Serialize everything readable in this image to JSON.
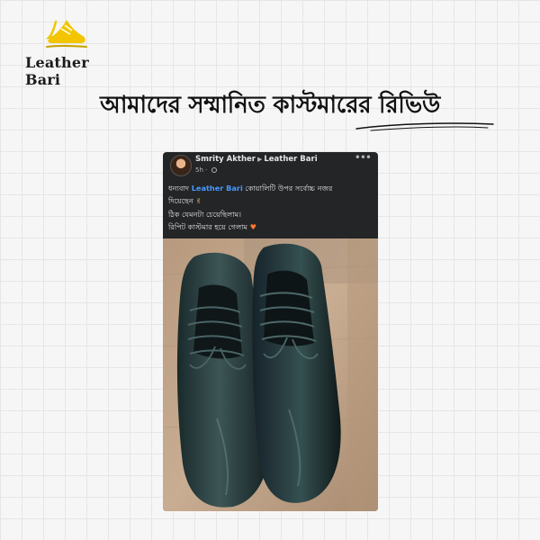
{
  "brand": {
    "name": "Leather Bari"
  },
  "headline": "আমাদের সম্মানিত কাস্টমারের রিভিউ",
  "post": {
    "author": "Smrity Akther",
    "page": "Leather Bari",
    "time": "5h",
    "lines": [
      {
        "before": "ধন্যবাদ ",
        "mention": "Leather Bari",
        "after": " কোয়ালিটি উপর সর্বোচ্চ  নজর"
      },
      {
        "text": "দিয়েছেন",
        "emoji": "hand-icon"
      },
      {
        "text": "ঠিক যেমনটা চেয়েছিলাম।"
      },
      {
        "text": "রিপিট কাস্টমার হয়ে গেলাম",
        "emoji": "heart-eyes-icon"
      }
    ],
    "photo": {
      "subject": "black leather lace-up shoes",
      "icon": "shoes-photo"
    }
  },
  "colors": {
    "card_bg": "#242526",
    "mention": "#4599ff",
    "logo_accent": "#f2c500"
  }
}
